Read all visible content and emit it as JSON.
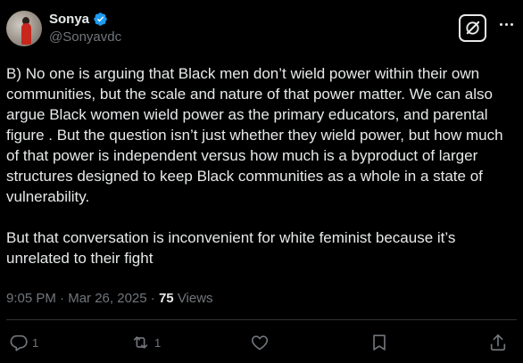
{
  "author": {
    "display_name": "Sonya",
    "handle": "@Sonyavdc",
    "verified": true
  },
  "tweet": {
    "text": "B) No one is arguing that Black men don’t wield power within their own communities, but the scale and nature of that power matter. We can also argue Black women wield power as the primary educators, and parental figure . But the question isn’t just whether they wield power, but how much of that power is independent versus how much is a byproduct of larger structures designed to keep Black communities as a whole in a state of vulnerability.\n\nBut that conversation is inconvenient for white feminist because it’s unrelated to their fight",
    "time": "9:05 PM",
    "separator": "·",
    "date": "Mar 26, 2025",
    "views_count": "75",
    "views_label": "Views"
  },
  "actions": {
    "reply_count": "1",
    "retweet_count": "1",
    "icons": [
      "reply-icon",
      "retweet-icon",
      "like-icon",
      "bookmark-icon",
      "share-icon"
    ]
  },
  "colors": {
    "background": "#000000",
    "text": "#e7e9ea",
    "muted": "#71767b",
    "verified": "#1d9bf0",
    "divider": "#2f3336"
  }
}
